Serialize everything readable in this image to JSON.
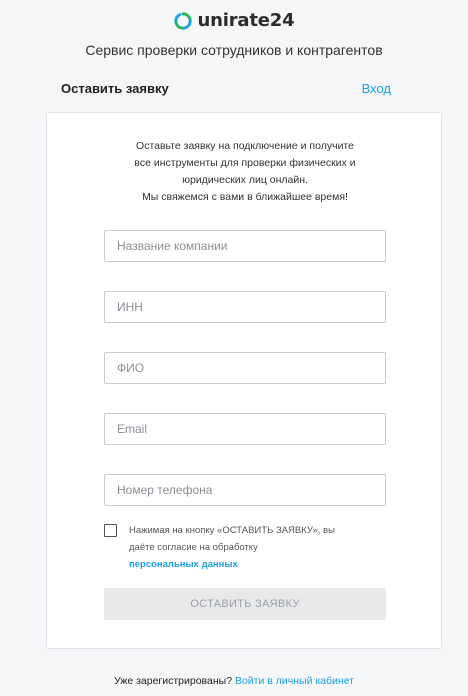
{
  "header": {
    "logo_text": "unirate24",
    "subtitle": "Сервис проверки сотрудников и контрагентов"
  },
  "topbar": {
    "title": "Оставить заявку",
    "login": "Вход"
  },
  "intro": {
    "lines": [
      "Оставьте заявку на подключение и получите",
      "все инструменты для проверки физических и",
      "юридических лиц онлайн.",
      "Мы свяжемся с вами в ближайшее время!"
    ]
  },
  "form": {
    "company": {
      "placeholder": "Название компании",
      "value": ""
    },
    "inn": {
      "placeholder": "ИНН",
      "value": ""
    },
    "fio": {
      "placeholder": "ФИО",
      "value": ""
    },
    "email": {
      "placeholder": "Email",
      "value": ""
    },
    "phone": {
      "placeholder": "Номер телефона",
      "value": ""
    },
    "consent_text_1": "Нажимая на кнопку «ОСТАВИТЬ ЗАЯВКУ», вы",
    "consent_text_2": "даёте согласие на обработку",
    "consent_link": "персональных данных",
    "submit_label": "ОСТАВИТЬ ЗАЯВКУ"
  },
  "footer": {
    "text": "Уже зарегистрированы?",
    "link": "Войти в личный кабинет"
  },
  "colors": {
    "accent": "#1aa0e5",
    "logo_green": "#25b36a"
  },
  "icons": {
    "logo": "unirate-logo-icon"
  }
}
